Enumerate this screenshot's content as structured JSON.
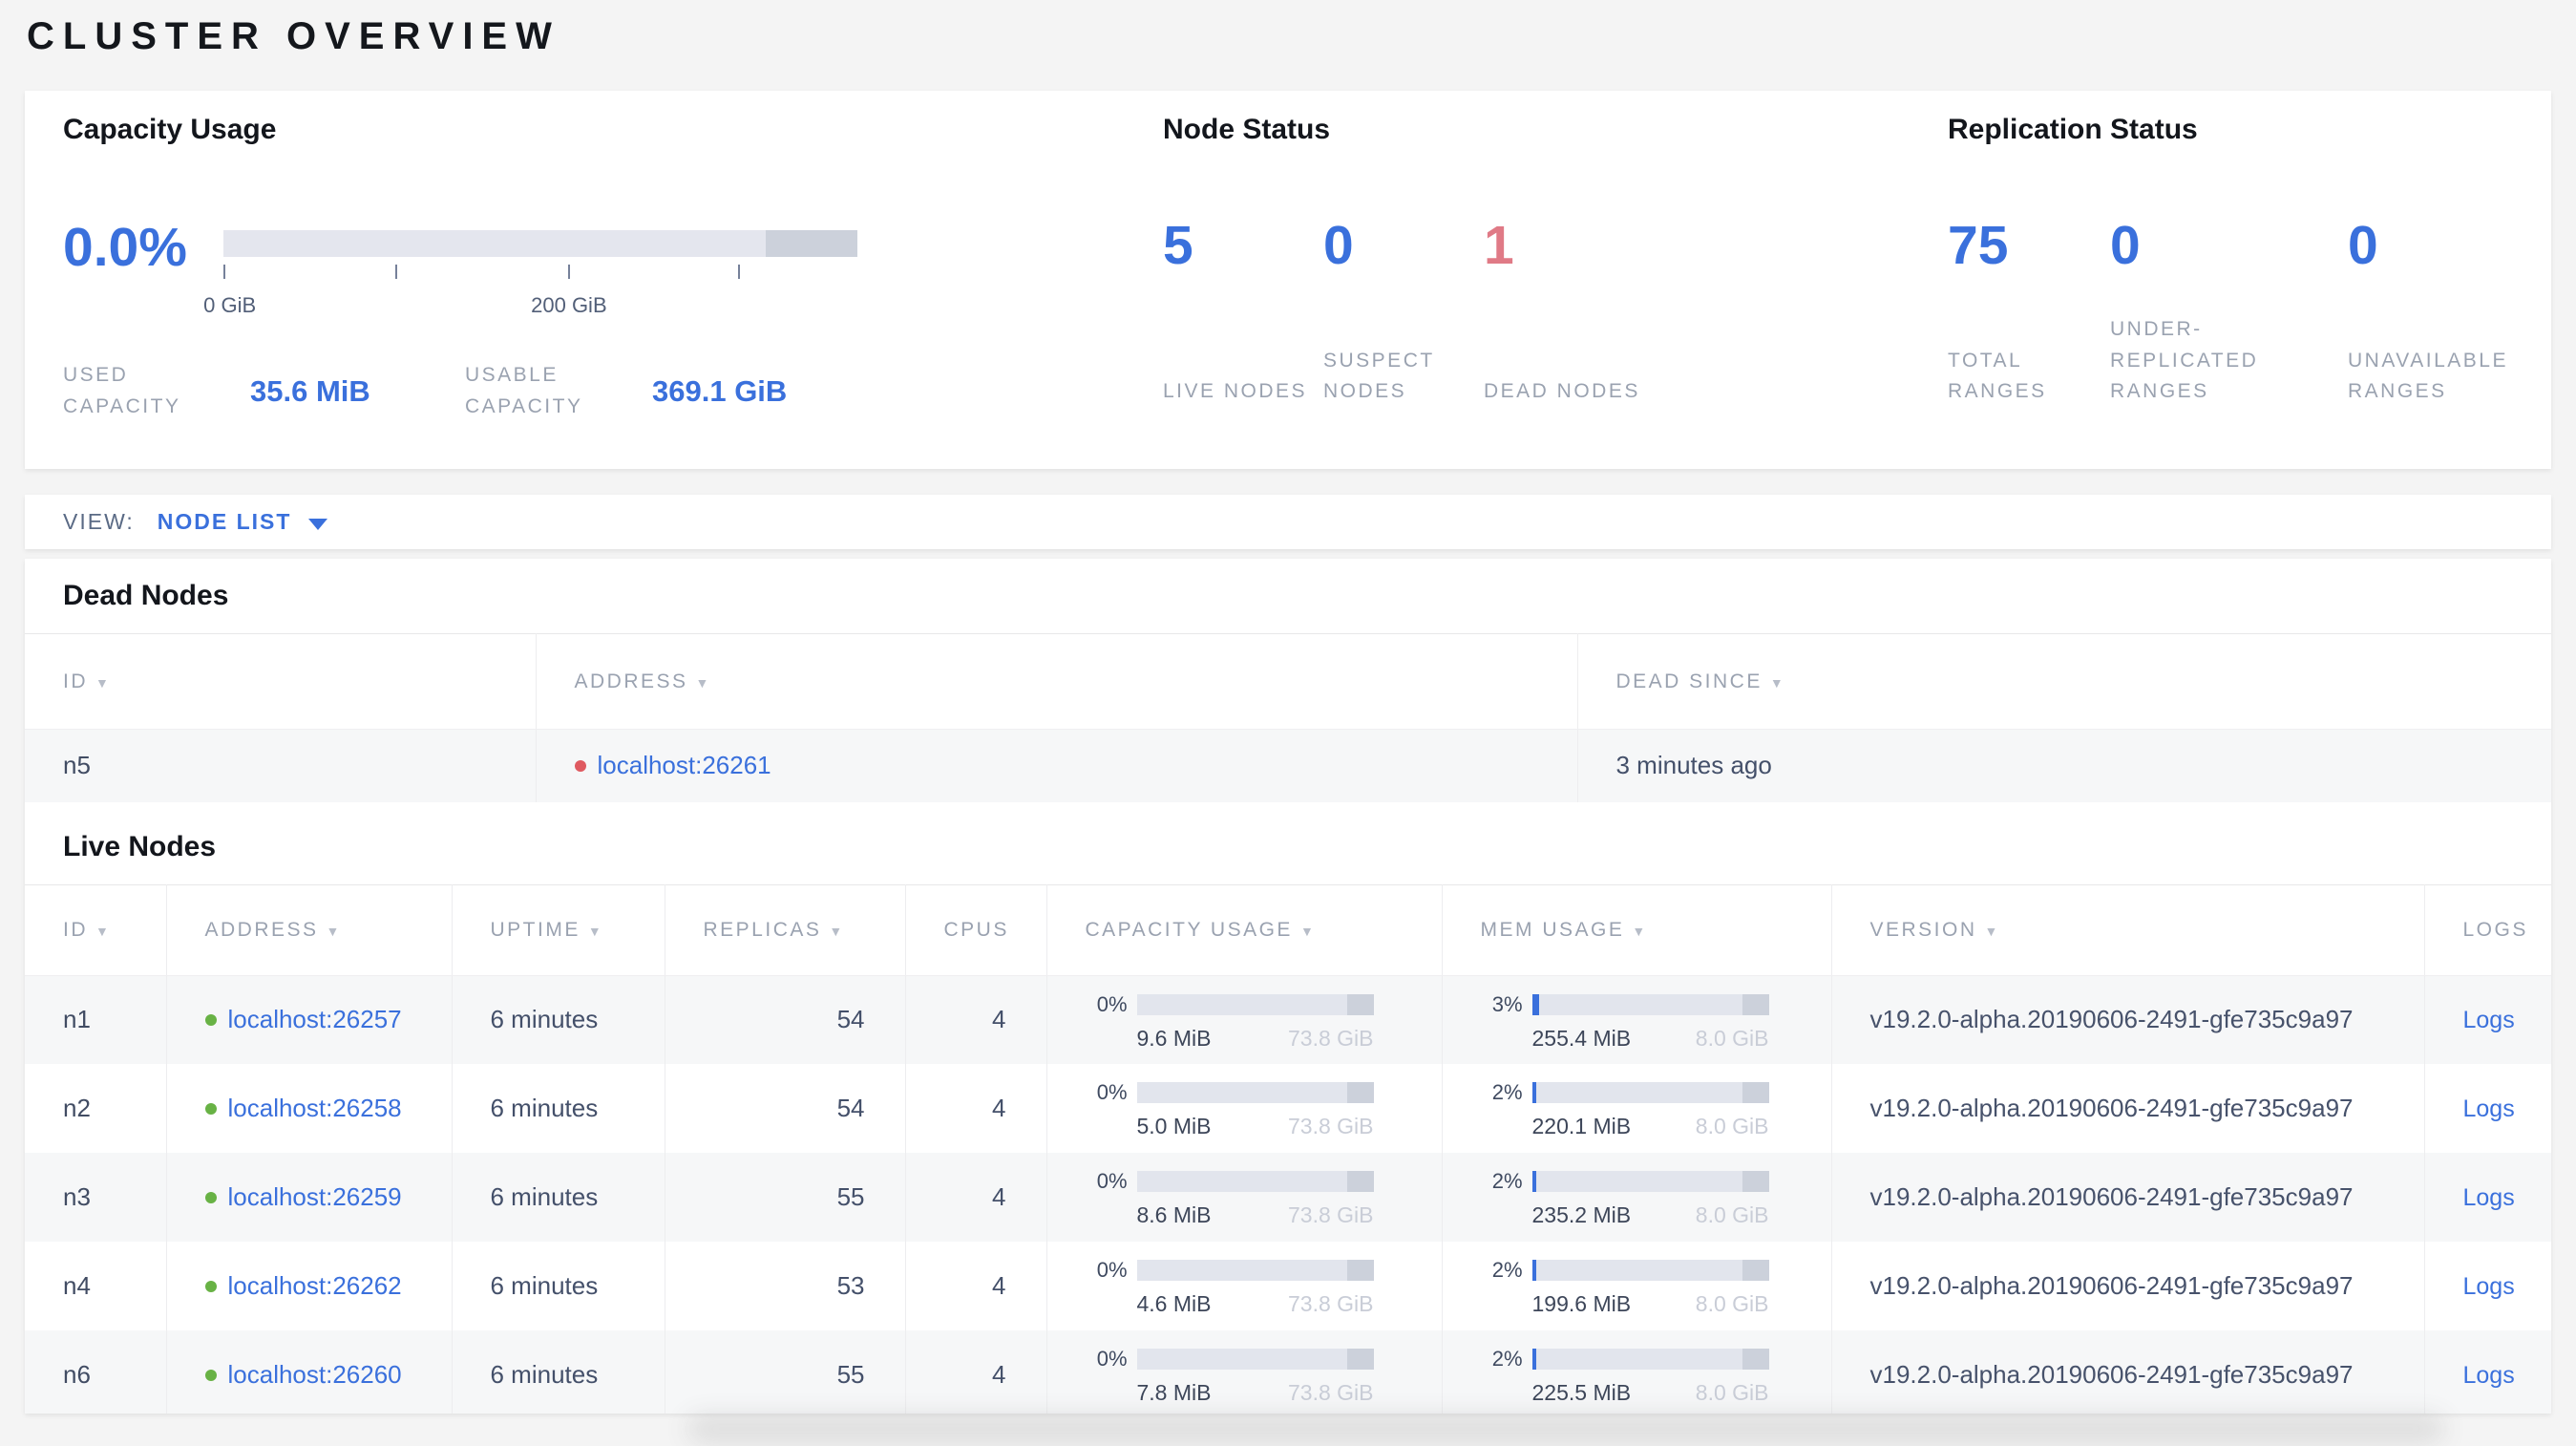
{
  "page_title": "CLUSTER OVERVIEW",
  "colors": {
    "accent_blue": "#3a70dc",
    "danger_red": "#e07a86",
    "live_dot_green": "#68b245",
    "dead_dot_red": "#df5a60",
    "bar_track": "#e2e5ed",
    "bar_reserved": "#ccd1db"
  },
  "icons": {
    "sort_desc_icon": "▼",
    "chevron_down_icon": "triangle-down",
    "live_status_icon": "green-dot",
    "dead_status_icon": "red-dot"
  },
  "summary": {
    "capacity": {
      "title": "Capacity Usage",
      "percent": "0.0%",
      "bar": {
        "light_pct": 85.5,
        "dark_pct": 14.5,
        "tick_labels": [
          "0 GiB",
          "200 GiB"
        ]
      },
      "used_label": "USED CAPACITY",
      "used_value": "35.6 MiB",
      "usable_label": "USABLE CAPACITY",
      "usable_value": "369.1 GiB"
    },
    "node_status": {
      "title": "Node Status",
      "stats": [
        {
          "value": "5",
          "label": "LIVE NODES"
        },
        {
          "value": "0",
          "label": "SUSPECT NODES"
        },
        {
          "value": "1",
          "label": "DEAD NODES"
        }
      ]
    },
    "replication": {
      "title": "Replication Status",
      "stats": [
        {
          "value": "75",
          "label": "TOTAL RANGES"
        },
        {
          "value": "0",
          "label": "UNDER-REPLICATED RANGES"
        },
        {
          "value": "0",
          "label": "UNAVAILABLE RANGES"
        }
      ]
    }
  },
  "view_bar": {
    "label": "VIEW:",
    "selected": "NODE LIST"
  },
  "dead_nodes": {
    "title": "Dead Nodes",
    "columns": [
      {
        "label": "ID",
        "sortable": true
      },
      {
        "label": "ADDRESS",
        "sortable": true
      },
      {
        "label": "DEAD SINCE",
        "sortable": true
      }
    ],
    "rows": [
      {
        "id": "n5",
        "status": "dead",
        "address": "localhost:26261",
        "dead_since": "3 minutes ago"
      }
    ]
  },
  "live_nodes": {
    "title": "Live Nodes",
    "columns": [
      {
        "label": "ID",
        "sortable": true
      },
      {
        "label": "ADDRESS",
        "sortable": true
      },
      {
        "label": "UPTIME",
        "sortable": true
      },
      {
        "label": "REPLICAS",
        "sortable": true
      },
      {
        "label": "CPUS",
        "sortable": false
      },
      {
        "label": "CAPACITY USAGE",
        "sortable": true
      },
      {
        "label": "MEM USAGE",
        "sortable": true
      },
      {
        "label": "VERSION",
        "sortable": true
      },
      {
        "label": "LOGS",
        "sortable": false
      }
    ],
    "rows": [
      {
        "id": "n1",
        "status": "live",
        "address": "localhost:26257",
        "uptime": "6 minutes",
        "replicas": "54",
        "cpus": "4",
        "capacity": {
          "percent": "0%",
          "fill_pct": 0,
          "used": "9.6 MiB",
          "total": "73.8 GiB"
        },
        "memory": {
          "percent": "3%",
          "fill_pct": 3,
          "used": "255.4 MiB",
          "total": "8.0 GiB"
        },
        "version": "v19.2.0-alpha.20190606-2491-gfe735c9a97",
        "logs_label": "Logs"
      },
      {
        "id": "n2",
        "status": "live",
        "address": "localhost:26258",
        "uptime": "6 minutes",
        "replicas": "54",
        "cpus": "4",
        "capacity": {
          "percent": "0%",
          "fill_pct": 0,
          "used": "5.0 MiB",
          "total": "73.8 GiB"
        },
        "memory": {
          "percent": "2%",
          "fill_pct": 2,
          "used": "220.1 MiB",
          "total": "8.0 GiB"
        },
        "version": "v19.2.0-alpha.20190606-2491-gfe735c9a97",
        "logs_label": "Logs"
      },
      {
        "id": "n3",
        "status": "live",
        "address": "localhost:26259",
        "uptime": "6 minutes",
        "replicas": "55",
        "cpus": "4",
        "capacity": {
          "percent": "0%",
          "fill_pct": 0,
          "used": "8.6 MiB",
          "total": "73.8 GiB"
        },
        "memory": {
          "percent": "2%",
          "fill_pct": 2,
          "used": "235.2 MiB",
          "total": "8.0 GiB"
        },
        "version": "v19.2.0-alpha.20190606-2491-gfe735c9a97",
        "logs_label": "Logs"
      },
      {
        "id": "n4",
        "status": "live",
        "address": "localhost:26262",
        "uptime": "6 minutes",
        "replicas": "53",
        "cpus": "4",
        "capacity": {
          "percent": "0%",
          "fill_pct": 0,
          "used": "4.6 MiB",
          "total": "73.8 GiB"
        },
        "memory": {
          "percent": "2%",
          "fill_pct": 2,
          "used": "199.6 MiB",
          "total": "8.0 GiB"
        },
        "version": "v19.2.0-alpha.20190606-2491-gfe735c9a97",
        "logs_label": "Logs"
      },
      {
        "id": "n6",
        "status": "live",
        "address": "localhost:26260",
        "uptime": "6 minutes",
        "replicas": "55",
        "cpus": "4",
        "capacity": {
          "percent": "0%",
          "fill_pct": 0,
          "used": "7.8 MiB",
          "total": "73.8 GiB"
        },
        "memory": {
          "percent": "2%",
          "fill_pct": 2,
          "used": "225.5 MiB",
          "total": "8.0 GiB"
        },
        "version": "v19.2.0-alpha.20190606-2491-gfe735c9a97",
        "logs_label": "Logs"
      }
    ]
  }
}
